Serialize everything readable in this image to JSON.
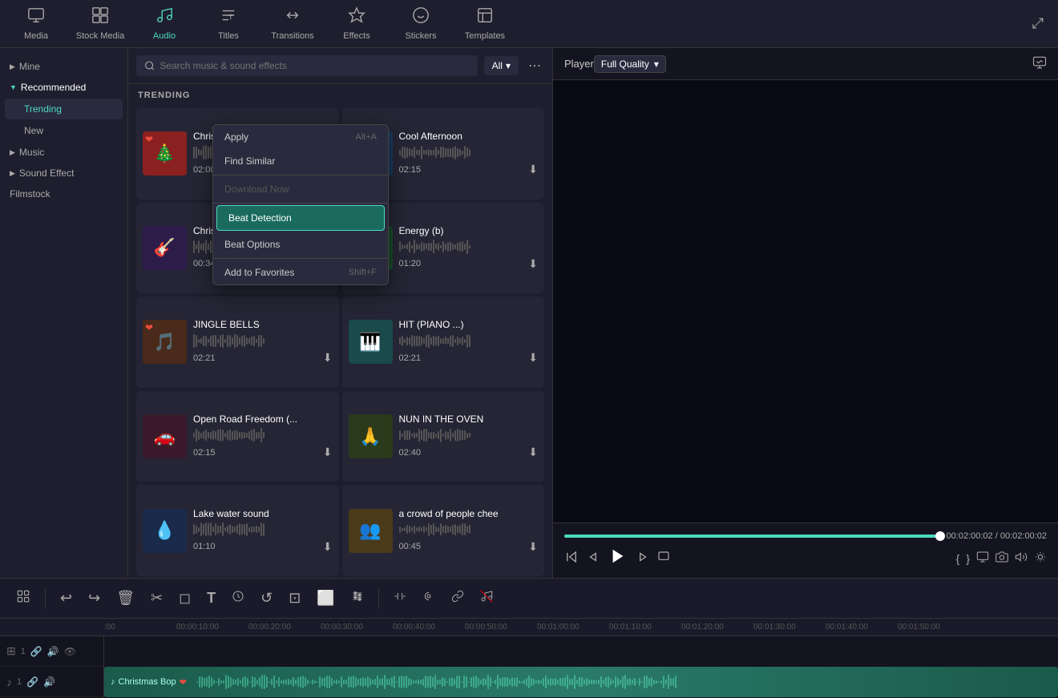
{
  "toolbar": {
    "items": [
      {
        "id": "media",
        "label": "Media",
        "icon": "⬜",
        "active": false
      },
      {
        "id": "stock-media",
        "label": "Stock Media",
        "icon": "🎬",
        "active": false
      },
      {
        "id": "audio",
        "label": "Audio",
        "icon": "♪",
        "active": true
      },
      {
        "id": "titles",
        "label": "Titles",
        "icon": "T",
        "active": false
      },
      {
        "id": "transitions",
        "label": "Transitions",
        "icon": "↔",
        "active": false
      },
      {
        "id": "effects",
        "label": "Effects",
        "icon": "✦",
        "active": false
      },
      {
        "id": "stickers",
        "label": "Stickers",
        "icon": "😀",
        "active": false
      },
      {
        "id": "templates",
        "label": "Templates",
        "icon": "⊞",
        "active": false
      }
    ]
  },
  "sidebar": {
    "sections": [
      {
        "id": "mine",
        "label": "Mine",
        "expanded": false,
        "arrow": "▶"
      },
      {
        "id": "recommended",
        "label": "Recommended",
        "expanded": true,
        "arrow": "▼"
      },
      {
        "id": "music",
        "label": "Music",
        "expanded": false,
        "arrow": "▶"
      },
      {
        "id": "sound-effect",
        "label": "Sound Effect",
        "expanded": false,
        "arrow": "▶"
      },
      {
        "id": "filmstock",
        "label": "Filmstock",
        "expanded": false,
        "arrow": ""
      }
    ],
    "recommended_items": [
      {
        "id": "trending",
        "label": "Trending",
        "active": true
      },
      {
        "id": "new",
        "label": "New",
        "active": false
      }
    ]
  },
  "search": {
    "placeholder": "Search music & sound effects",
    "filter": "All"
  },
  "trending_label": "TRENDING",
  "music_items": [
    {
      "id": 1,
      "title": "Christmas Bop",
      "time": "02:00",
      "has_heart": true,
      "col": "left"
    },
    {
      "id": 2,
      "title": "Cool Afternoon",
      "time": "02:15",
      "has_heart": false,
      "col": "right"
    },
    {
      "id": 3,
      "title": "Christmas Sto...",
      "time": "00:34",
      "has_heart": false,
      "col": "left"
    },
    {
      "id": 4,
      "title": "Energy (b)",
      "time": "01:20",
      "has_heart": false,
      "col": "right"
    },
    {
      "id": 5,
      "title": "JINGLE BELLS",
      "time": "02:21",
      "has_heart": true,
      "col": "left"
    },
    {
      "id": 6,
      "title": "HIT (PIANO ...)",
      "time": "02:21",
      "has_heart": false,
      "col": "right"
    },
    {
      "id": 7,
      "title": "Open Road Freedom (...",
      "time": "02:15",
      "has_heart": false,
      "col": "left"
    },
    {
      "id": 8,
      "title": "NUN IN THE OVEN",
      "time": "02:40",
      "has_heart": false,
      "col": "right"
    },
    {
      "id": 9,
      "title": "Lake water sound",
      "time": "01:10",
      "has_heart": false,
      "col": "left"
    },
    {
      "id": 10,
      "title": "a crowd of people chee",
      "time": "00:45",
      "has_heart": false,
      "col": "right"
    }
  ],
  "context_menu": {
    "items": [
      {
        "id": "apply",
        "label": "Apply",
        "shortcut": "Alt+A",
        "type": "normal"
      },
      {
        "id": "find-similar",
        "label": "Find Similar",
        "shortcut": "",
        "type": "normal"
      },
      {
        "id": "sep1",
        "type": "divider"
      },
      {
        "id": "download-now",
        "label": "Download Now",
        "shortcut": "",
        "type": "disabled"
      },
      {
        "id": "sep2",
        "type": "divider"
      },
      {
        "id": "beat-detection",
        "label": "Beat Detection",
        "shortcut": "",
        "type": "highlighted"
      },
      {
        "id": "beat-options",
        "label": "Beat Options",
        "shortcut": "",
        "type": "normal"
      },
      {
        "id": "sep3",
        "type": "divider"
      },
      {
        "id": "add-favorites",
        "label": "Add to Favorites",
        "shortcut": "Shift+F",
        "type": "normal"
      }
    ]
  },
  "player": {
    "title": "Player",
    "quality": "Full Quality",
    "current_time": "00:02:00:02",
    "total_time": "00:02:00:02",
    "progress_percent": 100
  },
  "timeline": {
    "ruler_marks": [
      ":00",
      "00:00:10:00",
      "00:00:20:00",
      "00:00:30:00",
      "00:00:40:00",
      "00:00:50:00",
      "00:01:00:00",
      "00:01:10:00",
      "00:01:20:00",
      "00:01:30:00",
      "00:01:40:00",
      "00:01:50:00"
    ],
    "tracks": [
      {
        "id": "video",
        "icon": "⊞",
        "label": "1"
      },
      {
        "id": "audio",
        "icon": "♪",
        "label": "1",
        "has_clip": true,
        "clip_label": "Christmas Bop"
      }
    ]
  },
  "bottom_toolbar": {
    "tools": [
      "⊞",
      "↩",
      "↪",
      "🗑",
      "✂",
      "◎",
      "⬛",
      "T",
      "⏱",
      "↺",
      "⬜",
      "⬜",
      "⏱",
      "⬜",
      "⬜",
      "◉",
      "≡",
      "⬜",
      "⬜"
    ]
  }
}
